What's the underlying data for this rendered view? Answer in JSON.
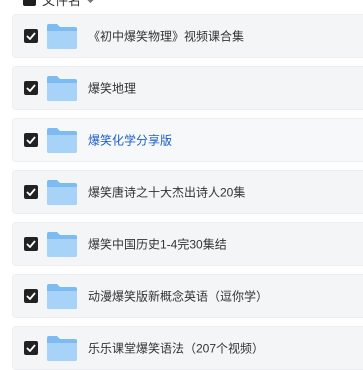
{
  "header": {
    "title": "文件名"
  },
  "rows": [
    {
      "name": "《初中爆笑物理》视频课合集",
      "checked": true
    },
    {
      "name": "爆笑地理",
      "checked": true
    },
    {
      "name": "爆笑化学分享版",
      "checked": true,
      "highlighted": true
    },
    {
      "name": "爆笑唐诗之十大杰出诗人20集",
      "checked": true
    },
    {
      "name": "爆笑中国历史1-4完30集结",
      "checked": true
    },
    {
      "name": "动漫爆笑版新概念英语（逗你学）",
      "checked": true
    },
    {
      "name": "乐乐课堂爆笑语法（207个视频）",
      "checked": true
    }
  ],
  "icons": {
    "row_icon": "folder-icon",
    "check_icon": "checkmark-icon",
    "sort_icon": "sort-arrow-icon"
  },
  "colors": {
    "folder": "#7cbcf2",
    "folder_light": "#a6d3f7",
    "link": "#1a5ec8",
    "checkbox": "#222222"
  }
}
